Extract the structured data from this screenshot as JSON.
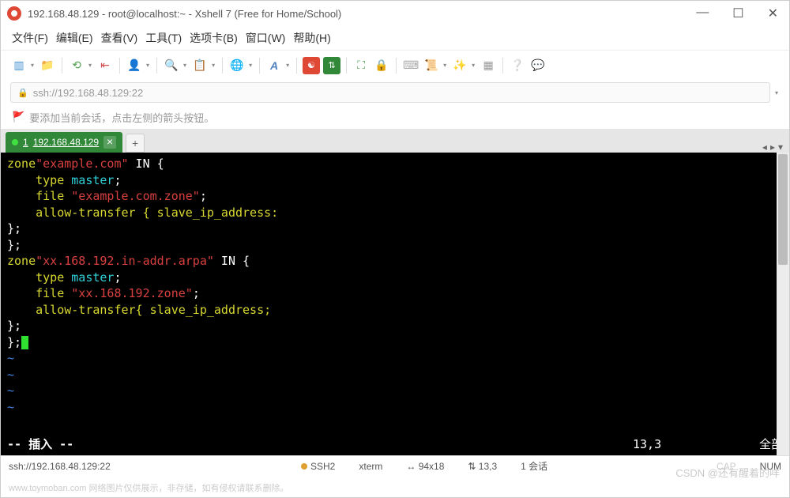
{
  "window": {
    "title": "192.168.48.129 - root@localhost:~ - Xshell 7 (Free for Home/School)"
  },
  "menu": {
    "file": "文件(F)",
    "edit": "编辑(E)",
    "view": "查看(V)",
    "tools": "工具(T)",
    "tabs": "选项卡(B)",
    "window": "窗口(W)",
    "help": "帮助(H)"
  },
  "address": {
    "url": "ssh://192.168.48.129:22"
  },
  "hint": {
    "text": "要添加当前会话，点击左侧的箭头按钮。"
  },
  "tab": {
    "index": "1",
    "label": "192.168.48.129"
  },
  "terminal": {
    "l1": {
      "a": "zone",
      "b": "\"example.com\"",
      "c": " IN {"
    },
    "l2": {
      "a": "    type ",
      "b": "master",
      "c": ";"
    },
    "l3": {
      "a": "    file ",
      "b": "\"example.com.zone\"",
      "c": ";"
    },
    "l4": "    allow-transfer { slave_ip_address:",
    "l5": "};",
    "l6": "};",
    "l7": "",
    "l8": {
      "a": "zone",
      "b": "\"xx.168.192.in-addr.arpa\"",
      "c": " IN {"
    },
    "l9": {
      "a": "    type ",
      "b": "master",
      "c": ";"
    },
    "l10": {
      "a": "    file ",
      "b": "\"xx.168.192.zone\"",
      "c": ";"
    },
    "l11": "    allow-transfer{ slave_ip_address;",
    "l12": "};",
    "l13": "};",
    "tilde": "~"
  },
  "vim": {
    "mode": "-- 插入 --",
    "pos": "13,3",
    "all": "全部"
  },
  "status": {
    "ssh": "ssh://192.168.48.129:22",
    "proto": "SSH2",
    "term": "xterm",
    "size": "94x18",
    "cursor": "13,3",
    "sessions": "1 会话",
    "cap": "CAP",
    "num": "NUM"
  },
  "watermark": "CSDN @还有醒着的咩",
  "watermark2": "www.toymoban.com 网络图片仅供展示，非存储，如有侵权请联系删除。"
}
